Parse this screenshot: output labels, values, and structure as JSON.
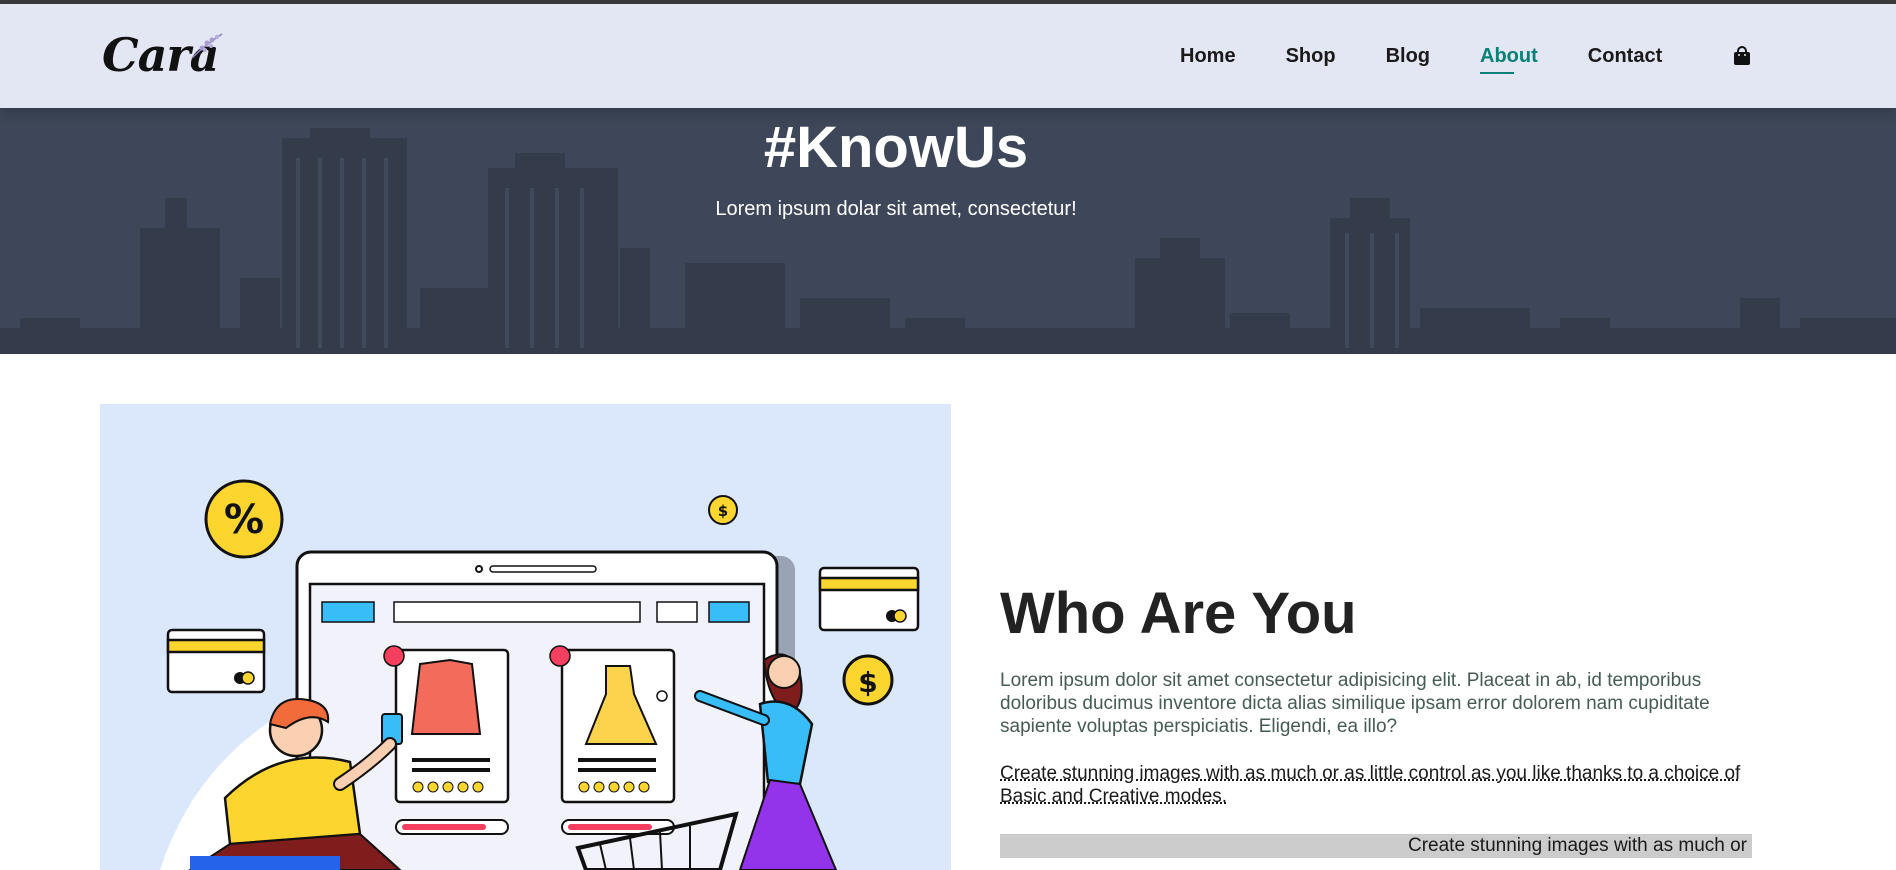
{
  "brand": {
    "logo_text": "Cara"
  },
  "nav": {
    "items": [
      {
        "label": "Home"
      },
      {
        "label": "Shop"
      },
      {
        "label": "Blog"
      },
      {
        "label": "About"
      },
      {
        "label": "Contact"
      }
    ],
    "active": "About",
    "cart_icon": "shopping-bag-icon"
  },
  "hero": {
    "title": "#KnowUs",
    "subtitle": "Lorem ipsum dolar sit amet, consectetur!"
  },
  "about": {
    "title": "Who Are You",
    "description": "Lorem ipsum dolor sit amet consectetur adipisicing elit. Placeat in ab, id temporibus doloribus ducimus inventore dicta alias similique ipsam error dolorem nam cupiditate sapiente voluptas perspiciatis. Eligendi, ea illo?",
    "abbr_text": "Create stunning images with as much or as little control as you like thanks to a choice of Basic and Creative modes.",
    "marquee_text": "Create stunning images with as much or"
  },
  "colors": {
    "header_bg": "#e3e6f3",
    "accent": "#088178",
    "hero_bg": "#3e4759",
    "illustration_bg": "#dbe7fb"
  }
}
